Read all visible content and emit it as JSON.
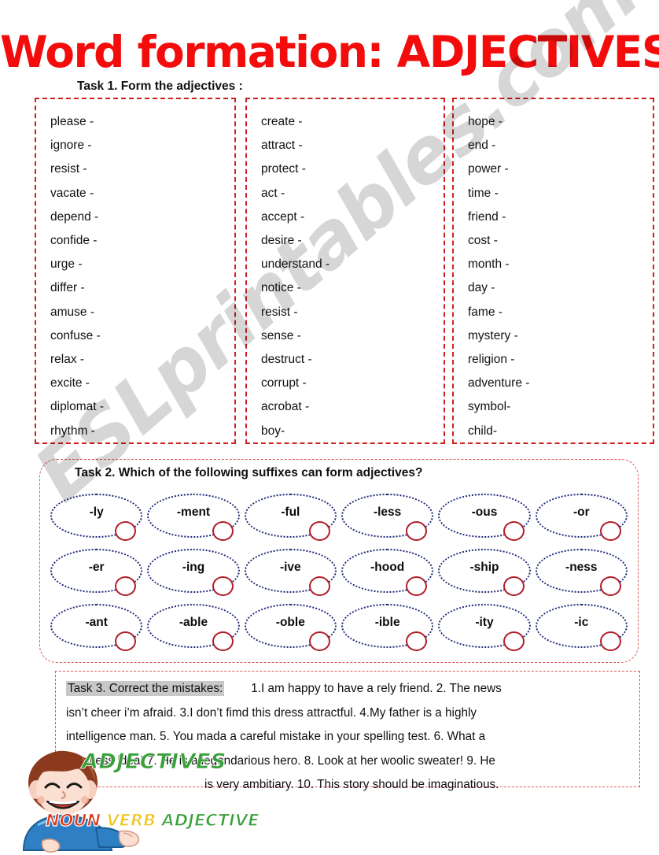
{
  "title": "Word formation: ADJECTIVES",
  "watermark": "ESLprintables.com",
  "colors": {
    "title_red": "#f20c0c",
    "box_border_red": "#cf2020",
    "oval_border_navy": "#1f2a78",
    "check_circle_red": "#b01e28",
    "adjectives_green": "#3aa03a",
    "highlight_gray": "#c8c8c8"
  },
  "task1": {
    "label": "Task 1. Form the adjectives :",
    "columns": [
      {
        "words": [
          "please -",
          "ignore -",
          "resist -",
          "vacate -",
          "depend -",
          "confide -",
          "urge -",
          "differ -",
          "amuse -",
          "confuse -",
          "relax -",
          "excite -",
          "diplomat -",
          "rhythm -"
        ]
      },
      {
        "words": [
          "create -",
          "attract -",
          "protect -",
          "act -",
          "accept -",
          "desire -",
          "understand -",
          "notice -",
          "resist -",
          "sense -",
          "destruct -",
          "corrupt -",
          "acrobat -",
          "boy-"
        ]
      },
      {
        "words": [
          "hope -",
          "end -",
          "power -",
          "time -",
          "friend -",
          "cost -",
          "month -",
          "day -",
          "fame -",
          "mystery -",
          "religion -",
          "adventure -",
          "symbol-",
          "child-"
        ]
      }
    ]
  },
  "task2": {
    "label": "Task 2. Which of the following suffixes can form adjectives?",
    "rows": [
      [
        "-ly",
        "-ment",
        "-ful",
        "-less",
        "-ous",
        "-or"
      ],
      [
        "-er",
        "-ing",
        "-ive",
        "-hood",
        "-ship",
        "-ness"
      ],
      [
        "-ant",
        "-able",
        "-oble",
        "-ible",
        "-ity",
        "-ic"
      ]
    ]
  },
  "task3": {
    "heading": "Task 3. Correct the mistakes:",
    "line1": "1.I am happy to have a rely friend. 2. The news",
    "line2": "isn’t cheer i’m afraid. 3.I don’t fimd this dress attractful.  4.My father is a highly",
    "line3": "intelligence man. 5. You mada a careful mistake in your spelling test. 6. What a",
    "line4": "creatless idea! 7.  He is a legendarious hero. 8. Look at her woolic sweater! 9. He",
    "line5": "is very ambitiary. 10. This story should be imaginatious."
  },
  "clipart": {
    "adjectives_word_art": "ADJECTIVES",
    "noun": "NOUN",
    "verb": "VERB",
    "adjective": "ADJECTIVE"
  }
}
